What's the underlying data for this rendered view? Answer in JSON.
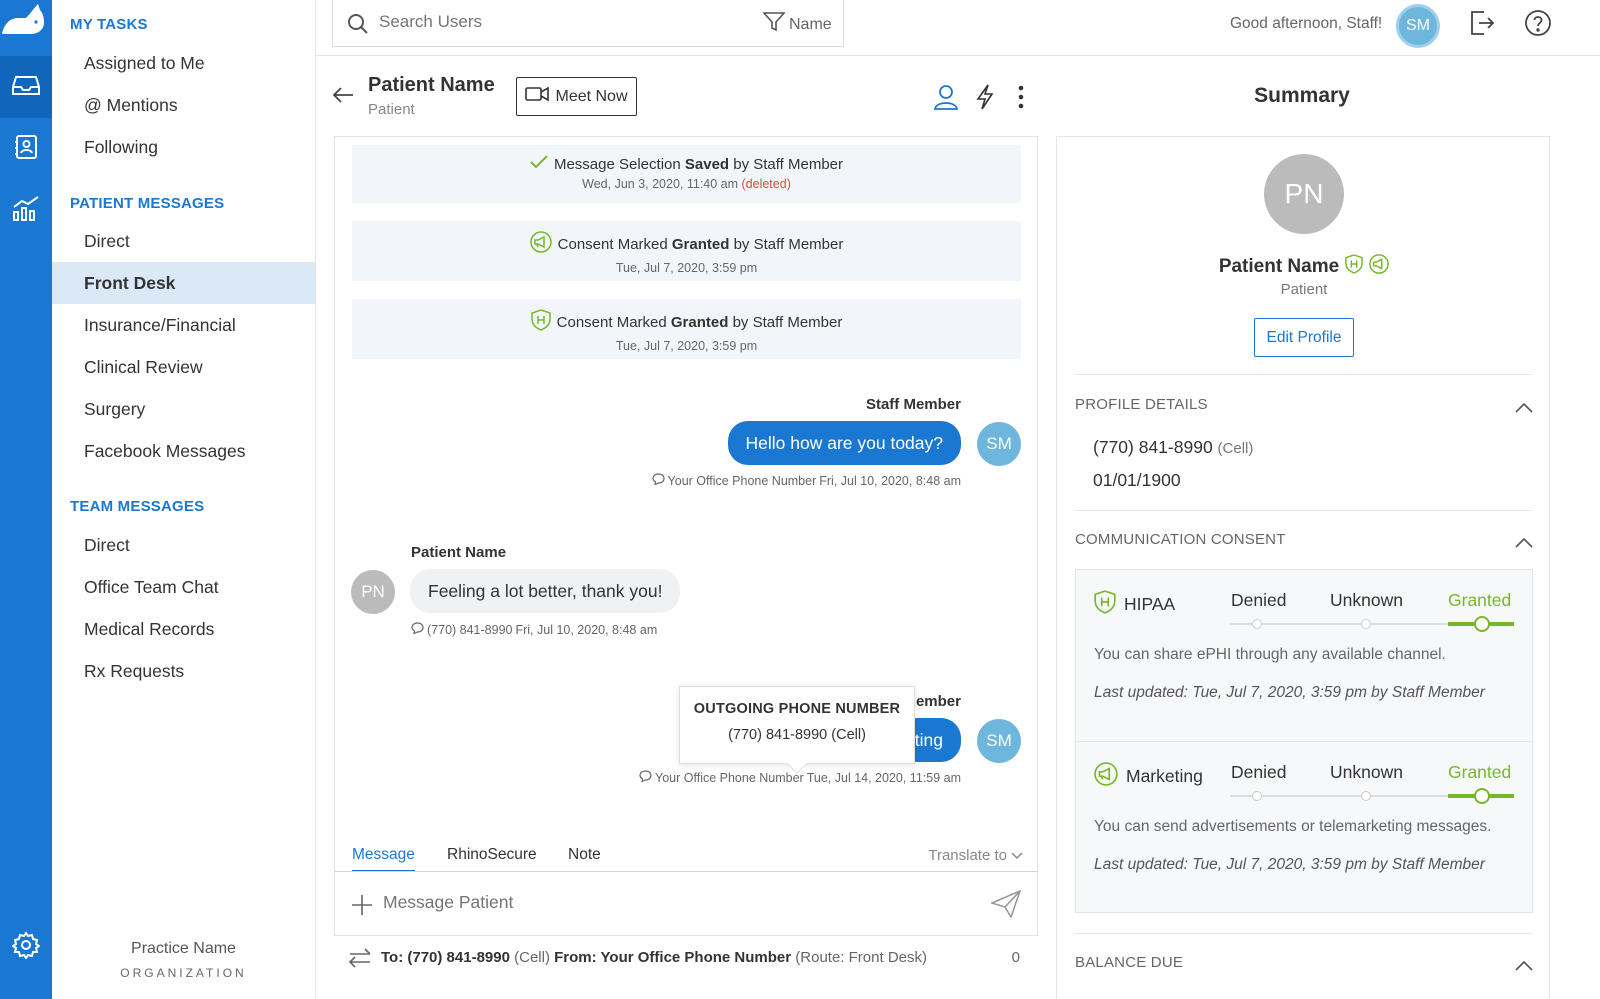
{
  "brand": {
    "logo_text": "rhinogram",
    "accent": "#1a78d2",
    "green": "#77b82a"
  },
  "rail": {
    "items": [
      {
        "icon": "inbox-icon",
        "active": true
      },
      {
        "icon": "contacts-icon",
        "active": false
      },
      {
        "icon": "analytics-icon",
        "active": false
      },
      {
        "icon": "gear-icon",
        "active": false
      }
    ]
  },
  "nav": {
    "my_tasks_title": "MY TASKS",
    "my_tasks": [
      "Assigned to Me",
      "@ Mentions",
      "Following"
    ],
    "patient_messages_title": "PATIENT MESSAGES",
    "patient_messages": [
      "Direct",
      "Front Desk",
      "Insurance/Financial",
      "Clinical Review",
      "Surgery",
      "Facebook Messages"
    ],
    "team_messages_title": "TEAM MESSAGES",
    "team_messages": [
      "Direct",
      "Office Team Chat",
      "Medical Records",
      "Rx Requests"
    ],
    "active_item": "Front Desk",
    "org_name": "Practice Name",
    "org_type": "ORGANIZATION"
  },
  "topbar": {
    "search_placeholder": "Search Users",
    "filter_label": "Name",
    "greeting": "Good afternoon, Staff!",
    "user_initials": "SM"
  },
  "conversation": {
    "patient_name": "Patient Name",
    "patient_type": "Patient",
    "meet_now_label": "Meet Now",
    "events": [
      {
        "prefix": "Message Selection ",
        "action": "Saved",
        "suffix": " by Staff Member",
        "time": "Wed, Jun 3, 2020, 11:40 am",
        "flag": "(deleted)",
        "icon": "check-icon"
      },
      {
        "prefix": "Consent Marked ",
        "action": "Granted",
        "suffix": " by Staff Member",
        "time": "Tue, Jul 7, 2020, 3:59 pm",
        "flag": "",
        "icon": "marketing-icon"
      },
      {
        "prefix": "Consent Marked ",
        "action": "Granted",
        "suffix": " by Staff Member",
        "time": "Tue, Jul 7, 2020, 3:59 pm",
        "flag": "",
        "icon": "hipaa-icon"
      }
    ],
    "messages": [
      {
        "sender": "Staff Member",
        "text": "Hello how are you today?",
        "initials": "SM",
        "channel": "Your Office Phone Number",
        "time": "Fri, Jul 10, 2020, 8:48 am"
      },
      {
        "sender": "Patient Name",
        "text": "Feeling a lot better, thank you!",
        "initials": "PN",
        "channel": "(770) 841-8990",
        "time": "Fri, Jul 10, 2020, 8:48 am"
      },
      {
        "sender_partial": "lember",
        "text_partial": "ting",
        "initials": "SM",
        "channel": "Your Office Phone Number",
        "time": "Tue, Jul 14, 2020, 11:59 am"
      }
    ],
    "tooltip": {
      "title": "OUTGOING PHONE NUMBER",
      "value": "(770) 841-8990 (Cell)"
    }
  },
  "compose": {
    "tabs": [
      "Message",
      "RhinoSecure",
      "Note"
    ],
    "active_tab": "Message",
    "translate_label": "Translate to",
    "placeholder": "Message Patient",
    "route_to_label": "To: (770) 841-8990",
    "route_to_type": "(Cell)",
    "route_from_label": "From: Your Office Phone Number",
    "route_name": "(Route: Front Desk)",
    "char_count": "0"
  },
  "summary": {
    "title": "Summary",
    "initials": "PN",
    "name": "Patient Name",
    "type": "Patient",
    "edit_label": "Edit Profile",
    "profile_section": "PROFILE DETAILS",
    "phone": "(770) 841-8990",
    "phone_type": "(Cell)",
    "dob": "01/01/1900",
    "consent_section": "COMMUNICATION CONSENT",
    "consent_options": [
      "Denied",
      "Unknown",
      "Granted"
    ],
    "consents": [
      {
        "name": "HIPAA",
        "icon": "hipaa-icon",
        "selected": "Granted",
        "description": "You can share ePHI through any available channel.",
        "updated": "Last updated: Tue, Jul 7, 2020, 3:59 pm by Staff Member"
      },
      {
        "name": "Marketing",
        "icon": "marketing-icon",
        "selected": "Granted",
        "description": "You can send advertisements or telemarketing messages.",
        "updated": "Last updated: Tue, Jul 7, 2020, 3:59 pm by Staff Member"
      }
    ],
    "balance_section": "BALANCE DUE"
  }
}
